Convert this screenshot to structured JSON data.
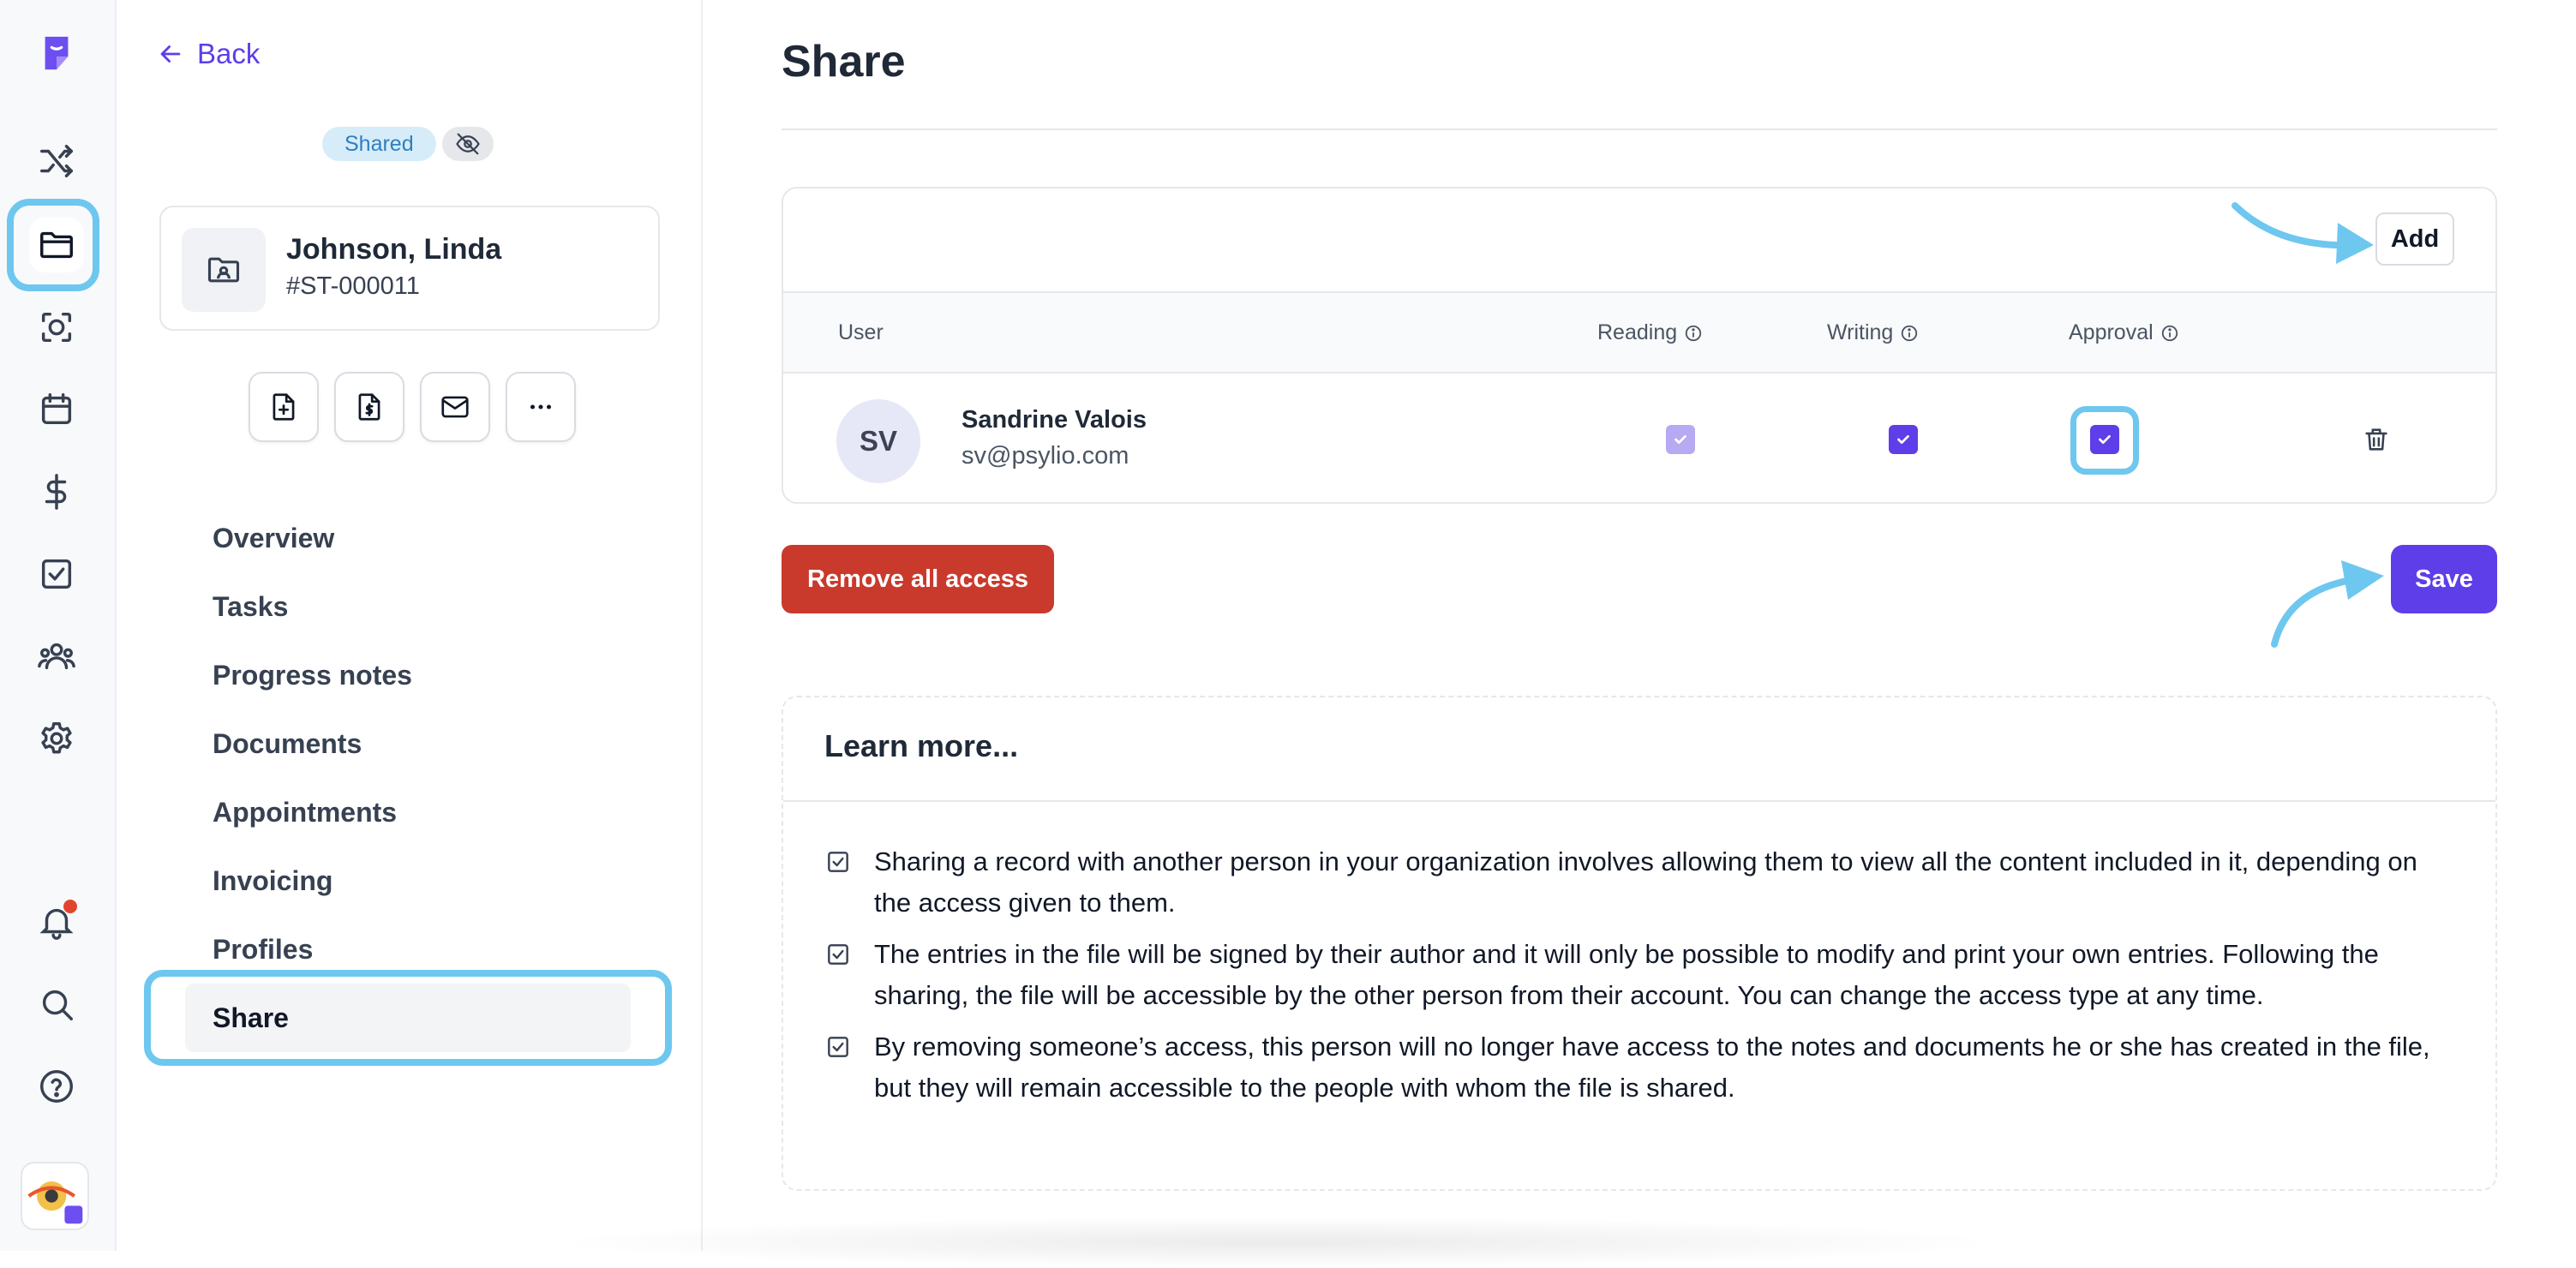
{
  "nav_back": "Back",
  "badges": {
    "shared": "Shared"
  },
  "client": {
    "name": "Johnson, Linda",
    "id": "#ST-000011"
  },
  "nav_items": [
    {
      "label": "Overview"
    },
    {
      "label": "Tasks"
    },
    {
      "label": "Progress notes"
    },
    {
      "label": "Documents"
    },
    {
      "label": "Appointments"
    },
    {
      "label": "Invoicing"
    },
    {
      "label": "Profiles"
    },
    {
      "label": "Share",
      "active": true
    }
  ],
  "page": {
    "title": "Share"
  },
  "share": {
    "add_label": "Add",
    "columns": {
      "user": "User",
      "reading": "Reading",
      "writing": "Writing",
      "approval": "Approval"
    },
    "rows": [
      {
        "initials": "SV",
        "name": "Sandrine Valois",
        "email": "sv@psylio.com",
        "reading": true,
        "reading_disabled": true,
        "writing": true,
        "approval": true
      }
    ],
    "remove_all_label": "Remove all access",
    "save_label": "Save"
  },
  "learn": {
    "title": "Learn more...",
    "items": [
      "Sharing a record with another person in your organization involves allowing them to view all the content included in it, depending on the access given to them.",
      "The entries in the file will be signed by their author and it will only be possible to modify and print your own entries. Following the sharing, the file will be accessible by the other person from their account. You can change the access type at any time.",
      "By removing someone’s access, this person will no longer have access to the notes and documents he or she has created in the file, but they will remain accessible to the people with whom the file is shared."
    ]
  },
  "colors": {
    "accent": "#5d3ee8",
    "danger": "#c93a2c",
    "highlight": "#6ec7ef",
    "badge_bg": "#d6ecf9",
    "notification": "#e2452f"
  },
  "icons": {
    "rail": [
      "app-logo-icon",
      "shuffle-icon",
      "folder-icon",
      "scan-face-icon",
      "calendar-icon",
      "dollar-icon",
      "checkbox-icon",
      "users-icon",
      "gear-icon",
      "bell-icon",
      "search-icon",
      "help-icon"
    ],
    "actions": [
      "file-plus-icon",
      "file-invoice-icon",
      "mail-icon",
      "more-icon"
    ]
  }
}
